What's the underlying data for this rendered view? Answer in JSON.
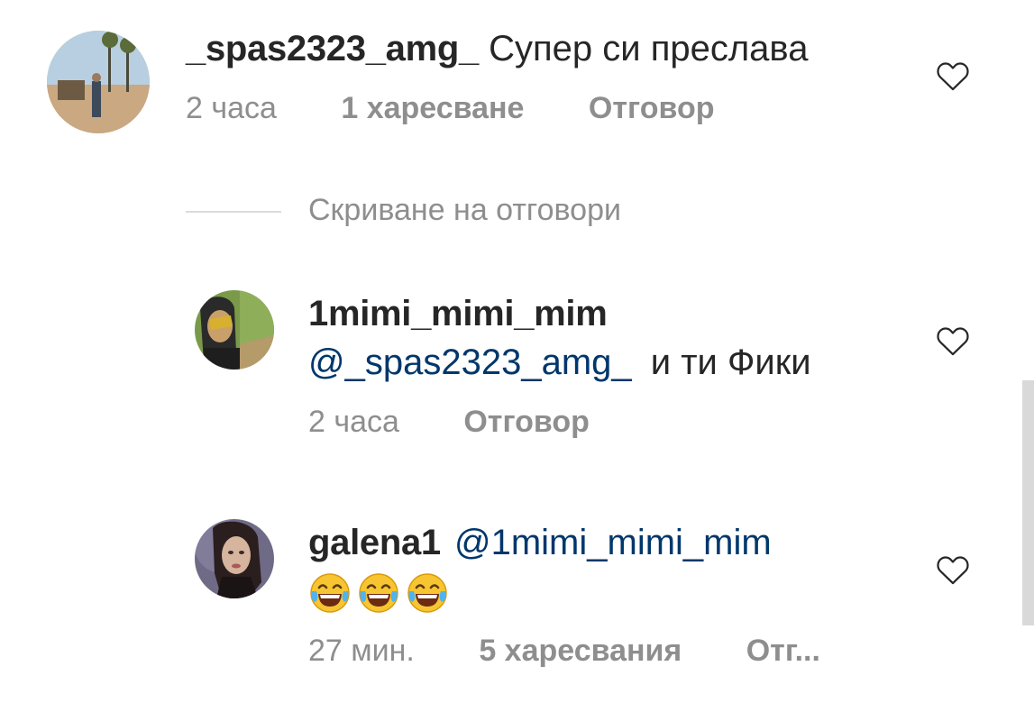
{
  "comments": [
    {
      "username": "_spas2323_amg_",
      "text": "Супер си преслава",
      "time": "2 часа",
      "likes": "1 харесване",
      "reply": "Отговор"
    },
    {
      "username": "1mimi_mimi_mim",
      "mention": "@_spas2323_amg_",
      "text": "и ти Фики",
      "time": "2 часа",
      "reply": "Отговор"
    },
    {
      "username": "galena1",
      "mention": "@1mimi_mimi_mim",
      "emojis": [
        "face-with-tears-of-joy",
        "face-with-tears-of-joy",
        "face-with-tears-of-joy"
      ],
      "time": "27 мин.",
      "likes": "5 харесвания",
      "reply": "Отг..."
    }
  ],
  "replies_toggle": "Скриване на отговори",
  "icons": {
    "like": "heart-outline-icon"
  },
  "colors": {
    "text": "#262626",
    "secondary": "#8e8e8e",
    "mention": "#00376b",
    "divider": "#dbdbdb"
  }
}
